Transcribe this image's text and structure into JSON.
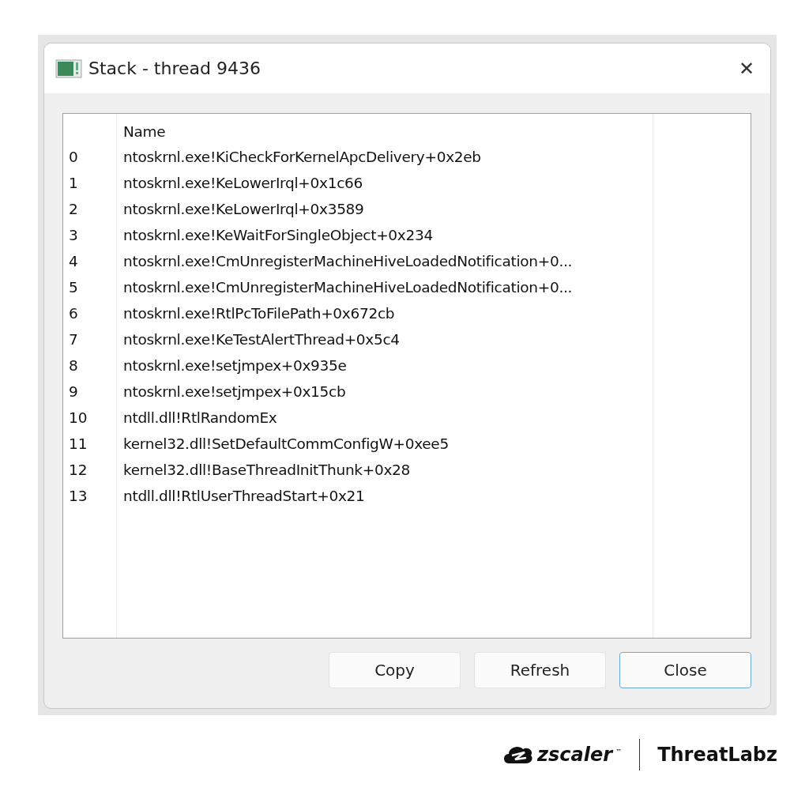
{
  "window": {
    "title": "Stack - thread 9436",
    "close_glyph": "✕"
  },
  "table": {
    "columns": [
      "",
      "Name"
    ],
    "rows": [
      [
        "0",
        "ntoskrnl.exe!KiCheckForKernelApcDelivery+0x2eb"
      ],
      [
        "1",
        "ntoskrnl.exe!KeLowerIrql+0x1c66"
      ],
      [
        "2",
        "ntoskrnl.exe!KeLowerIrql+0x3589"
      ],
      [
        "3",
        "ntoskrnl.exe!KeWaitForSingleObject+0x234"
      ],
      [
        "4",
        "ntoskrnl.exe!CmUnregisterMachineHiveLoadedNotification+0..."
      ],
      [
        "5",
        "ntoskrnl.exe!CmUnregisterMachineHiveLoadedNotification+0..."
      ],
      [
        "6",
        "ntoskrnl.exe!RtlPcToFilePath+0x672cb"
      ],
      [
        "7",
        "ntoskrnl.exe!KeTestAlertThread+0x5c4"
      ],
      [
        "8",
        "ntoskrnl.exe!setjmpex+0x935e"
      ],
      [
        "9",
        "ntoskrnl.exe!setjmpex+0x15cb"
      ],
      [
        "10",
        "ntdll.dll!RtlRandomEx"
      ],
      [
        "11",
        "kernel32.dll!SetDefaultCommConfigW+0xee5"
      ],
      [
        "12",
        "kernel32.dll!BaseThreadInitThunk+0x28"
      ],
      [
        "13",
        "ntdll.dll!RtlUserThreadStart+0x21"
      ]
    ]
  },
  "buttons": [
    {
      "label": "Copy",
      "default": false
    },
    {
      "label": "Refresh",
      "default": false
    },
    {
      "label": "Close",
      "default": true
    }
  ],
  "footer": {
    "brand": "zscaler",
    "trademark": "™",
    "product": "ThreatLabz"
  }
}
